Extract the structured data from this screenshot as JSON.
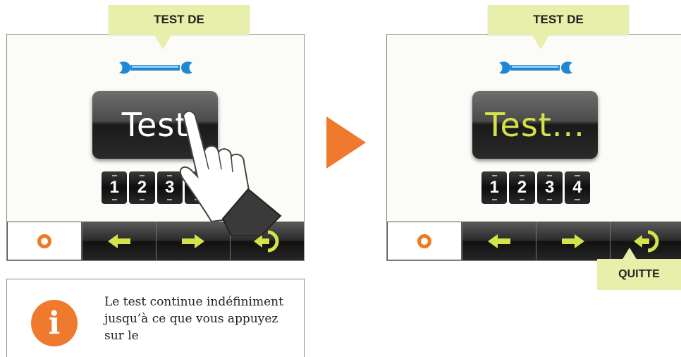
{
  "left_panel": {
    "callout_label": "TEST DE",
    "test_button_label": "Test",
    "numbers": [
      "1",
      "2",
      "3",
      "4"
    ]
  },
  "right_panel": {
    "callout_label": "TEST DE",
    "test_button_label": "Test...",
    "numbers": [
      "1",
      "2",
      "3",
      "4"
    ],
    "quit_callout_label": "QUITTE"
  },
  "info": {
    "icon_glyph": "i",
    "text": "Le test continue indéfiniment jusqu’à ce que vous appuyez sur le"
  },
  "colors": {
    "accent_orange": "#ef7a2e",
    "callout_fill": "#e8efaa",
    "active_text": "#d5e24a",
    "wrench_blue": "#1e88d2"
  },
  "icons": {
    "bar_home": "search-q-icon",
    "bar_prev": "arrow-left-icon",
    "bar_next": "arrow-right-icon",
    "bar_exit": "exit-icon"
  }
}
